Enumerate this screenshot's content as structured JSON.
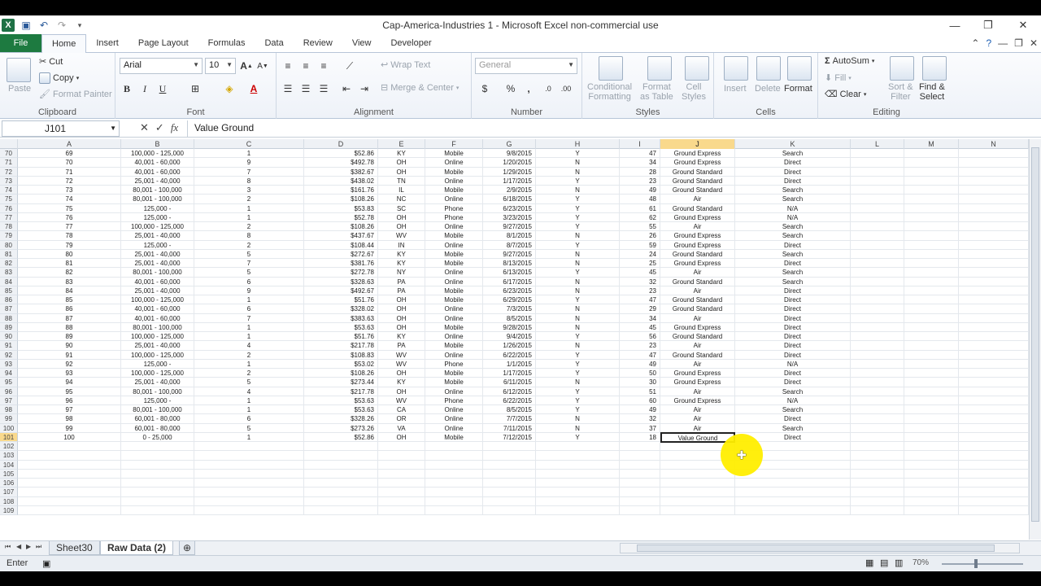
{
  "window": {
    "title": "Cap-America-Industries 1  -  Microsoft Excel non-commercial use",
    "app_icon": "excel-icon"
  },
  "qat": {
    "save": "save-icon",
    "undo": "undo-icon",
    "redo": "redo-icon",
    "customize": "customize-qat-icon"
  },
  "tabs": {
    "file": "File",
    "items": [
      "Home",
      "Insert",
      "Page Layout",
      "Formulas",
      "Data",
      "Review",
      "View",
      "Developer"
    ],
    "active": "Home"
  },
  "ribbon": {
    "clipboard": {
      "label": "Clipboard",
      "paste": "Paste",
      "cut": "Cut",
      "copy": "Copy",
      "format_painter": "Format Painter"
    },
    "font": {
      "label": "Font",
      "family": "Arial",
      "size": "10",
      "bold": "B",
      "italic": "I",
      "underline": "U"
    },
    "alignment": {
      "label": "Alignment",
      "wrap": "Wrap Text",
      "merge": "Merge & Center"
    },
    "number": {
      "label": "Number",
      "format": "General",
      "currency": "$",
      "percent": "%",
      "comma": ","
    },
    "styles": {
      "label": "Styles",
      "conditional": "Conditional",
      "conditional2": "Formatting",
      "format_table": "Format",
      "format_table2": "as Table",
      "cell_styles": "Cell",
      "cell_styles2": "Styles"
    },
    "cells": {
      "label": "Cells",
      "insert": "Insert",
      "delete": "Delete",
      "format": "Format"
    },
    "editing": {
      "label": "Editing",
      "autosum": "AutoSum",
      "fill": "Fill",
      "clear": "Clear",
      "sort": "Sort &",
      "sort2": "Filter",
      "find": "Find &",
      "find2": "Select"
    }
  },
  "formula_bar": {
    "name_box": "J101",
    "formula": "Value Ground"
  },
  "columns": [
    "A",
    "B",
    "C",
    "D",
    "E",
    "F",
    "G",
    "H",
    "I",
    "J",
    "K",
    "L",
    "M",
    "N"
  ],
  "selected_column": "J",
  "rows": [
    [
      "70",
      "69",
      "100,000 - 125,000",
      "1",
      "$52.86",
      "KY",
      "Mobile",
      "9/8/2015",
      "Y",
      "47",
      "Ground Express",
      "Search"
    ],
    [
      "71",
      "70",
      "40,001 - 60,000",
      "9",
      "$492.78",
      "OH",
      "Online",
      "1/20/2015",
      "N",
      "34",
      "Ground Express",
      "Direct"
    ],
    [
      "72",
      "71",
      "40,001 - 60,000",
      "7",
      "$382.67",
      "OH",
      "Mobile",
      "1/29/2015",
      "N",
      "28",
      "Ground Standard",
      "Direct"
    ],
    [
      "73",
      "72",
      "25,001 - 40,000",
      "8",
      "$438.02",
      "TN",
      "Online",
      "1/17/2015",
      "Y",
      "23",
      "Ground Standard",
      "Direct"
    ],
    [
      "74",
      "73",
      "80,001 - 100,000",
      "3",
      "$161.76",
      "IL",
      "Mobile",
      "2/9/2015",
      "N",
      "49",
      "Ground Standard",
      "Search"
    ],
    [
      "75",
      "74",
      "80,001 - 100,000",
      "2",
      "$108.26",
      "NC",
      "Online",
      "6/18/2015",
      "Y",
      "48",
      "Air",
      "Search"
    ],
    [
      "76",
      "75",
      "125,000 -",
      "1",
      "$53.83",
      "SC",
      "Phone",
      "6/23/2015",
      "Y",
      "61",
      "Ground Standard",
      "N/A"
    ],
    [
      "77",
      "76",
      "125,000 -",
      "1",
      "$52.78",
      "OH",
      "Phone",
      "3/23/2015",
      "Y",
      "62",
      "Ground Express",
      "N/A"
    ],
    [
      "78",
      "77",
      "100,000 - 125,000",
      "2",
      "$108.26",
      "OH",
      "Online",
      "9/27/2015",
      "Y",
      "55",
      "Air",
      "Search"
    ],
    [
      "79",
      "78",
      "25,001 - 40,000",
      "8",
      "$437.67",
      "WV",
      "Mobile",
      "8/1/2015",
      "N",
      "26",
      "Ground Express",
      "Search"
    ],
    [
      "80",
      "79",
      "125,000 -",
      "2",
      "$108.44",
      "IN",
      "Online",
      "8/7/2015",
      "Y",
      "59",
      "Ground Express",
      "Direct"
    ],
    [
      "81",
      "80",
      "25,001 - 40,000",
      "5",
      "$272.67",
      "KY",
      "Mobile",
      "9/27/2015",
      "N",
      "24",
      "Ground Standard",
      "Search"
    ],
    [
      "82",
      "81",
      "25,001 - 40,000",
      "7",
      "$381.76",
      "KY",
      "Mobile",
      "8/13/2015",
      "N",
      "25",
      "Ground Express",
      "Direct"
    ],
    [
      "83",
      "82",
      "80,001 - 100,000",
      "5",
      "$272.78",
      "NY",
      "Online",
      "6/13/2015",
      "Y",
      "45",
      "Air",
      "Search"
    ],
    [
      "84",
      "83",
      "40,001 - 60,000",
      "6",
      "$328.63",
      "PA",
      "Online",
      "6/17/2015",
      "N",
      "32",
      "Ground Standard",
      "Search"
    ],
    [
      "85",
      "84",
      "25,001 - 40,000",
      "9",
      "$492.67",
      "PA",
      "Mobile",
      "6/23/2015",
      "N",
      "23",
      "Air",
      "Direct"
    ],
    [
      "86",
      "85",
      "100,000 - 125,000",
      "1",
      "$51.76",
      "OH",
      "Mobile",
      "6/29/2015",
      "Y",
      "47",
      "Ground Standard",
      "Direct"
    ],
    [
      "87",
      "86",
      "40,001 - 60,000",
      "6",
      "$328.02",
      "OH",
      "Online",
      "7/3/2015",
      "N",
      "29",
      "Ground Standard",
      "Direct"
    ],
    [
      "88",
      "87",
      "40,001 - 60,000",
      "7",
      "$383.63",
      "OH",
      "Online",
      "8/5/2015",
      "N",
      "34",
      "Air",
      "Direct"
    ],
    [
      "89",
      "88",
      "80,001 - 100,000",
      "1",
      "$53.63",
      "OH",
      "Mobile",
      "9/28/2015",
      "N",
      "45",
      "Ground Express",
      "Direct"
    ],
    [
      "90",
      "89",
      "100,000 - 125,000",
      "1",
      "$51.76",
      "KY",
      "Online",
      "9/4/2015",
      "Y",
      "56",
      "Ground Standard",
      "Direct"
    ],
    [
      "91",
      "90",
      "25,001 - 40,000",
      "4",
      "$217.78",
      "PA",
      "Mobile",
      "1/26/2015",
      "N",
      "23",
      "Air",
      "Direct"
    ],
    [
      "92",
      "91",
      "100,000 - 125,000",
      "2",
      "$108.83",
      "WV",
      "Online",
      "6/22/2015",
      "Y",
      "47",
      "Ground Standard",
      "Direct"
    ],
    [
      "93",
      "92",
      "125,000 -",
      "1",
      "$53.02",
      "WV",
      "Phone",
      "1/1/2015",
      "Y",
      "49",
      "Air",
      "N/A"
    ],
    [
      "94",
      "93",
      "100,000 - 125,000",
      "2",
      "$108.26",
      "OH",
      "Mobile",
      "1/17/2015",
      "Y",
      "50",
      "Ground Express",
      "Direct"
    ],
    [
      "95",
      "94",
      "25,001 - 40,000",
      "5",
      "$273.44",
      "KY",
      "Mobile",
      "6/11/2015",
      "N",
      "30",
      "Ground Express",
      "Direct"
    ],
    [
      "96",
      "95",
      "80,001 - 100,000",
      "4",
      "$217.78",
      "OH",
      "Online",
      "6/12/2015",
      "Y",
      "51",
      "Air",
      "Search"
    ],
    [
      "97",
      "96",
      "125,000 -",
      "1",
      "$53.63",
      "WV",
      "Phone",
      "6/22/2015",
      "Y",
      "60",
      "Ground Express",
      "N/A"
    ],
    [
      "98",
      "97",
      "80,001 - 100,000",
      "1",
      "$53.63",
      "CA",
      "Online",
      "8/5/2015",
      "Y",
      "49",
      "Air",
      "Search"
    ],
    [
      "99",
      "98",
      "60,001 - 80,000",
      "6",
      "$328.26",
      "OR",
      "Online",
      "7/7/2015",
      "N",
      "32",
      "Air",
      "Direct"
    ],
    [
      "100",
      "99",
      "60,001 - 80,000",
      "5",
      "$273.26",
      "VA",
      "Online",
      "7/11/2015",
      "N",
      "37",
      "Air",
      "Search"
    ],
    [
      "101",
      "100",
      "0 - 25,000",
      "1",
      "$52.86",
      "OH",
      "Mobile",
      "7/12/2015",
      "Y",
      "18",
      "Value Ground",
      "Direct"
    ],
    [
      "102",
      "",
      "",
      "",
      "",
      "",
      "",
      "",
      "",
      "",
      "",
      ""
    ],
    [
      "103",
      "",
      "",
      "",
      "",
      "",
      "",
      "",
      "",
      "",
      "",
      ""
    ],
    [
      "104",
      "",
      "",
      "",
      "",
      "",
      "",
      "",
      "",
      "",
      "",
      ""
    ],
    [
      "105",
      "",
      "",
      "",
      "",
      "",
      "",
      "",
      "",
      "",
      "",
      ""
    ],
    [
      "106",
      "",
      "",
      "",
      "",
      "",
      "",
      "",
      "",
      "",
      "",
      ""
    ],
    [
      "107",
      "",
      "",
      "",
      "",
      "",
      "",
      "",
      "",
      "",
      "",
      ""
    ],
    [
      "108",
      "",
      "",
      "",
      "",
      "",
      "",
      "",
      "",
      "",
      "",
      ""
    ],
    [
      "109",
      "",
      "",
      "",
      "",
      "",
      "",
      "",
      "",
      "",
      "",
      ""
    ]
  ],
  "active_row": "101",
  "sheets": [
    "Sheet30",
    "Raw Data (2)"
  ],
  "active_sheet": "Raw Data (2)",
  "status": {
    "mode": "Enter",
    "zoom": "70%"
  },
  "colors": {
    "file_tab": "#1d7a40",
    "selection": "#f9d98c",
    "cursor_halo": "#ffee00"
  }
}
